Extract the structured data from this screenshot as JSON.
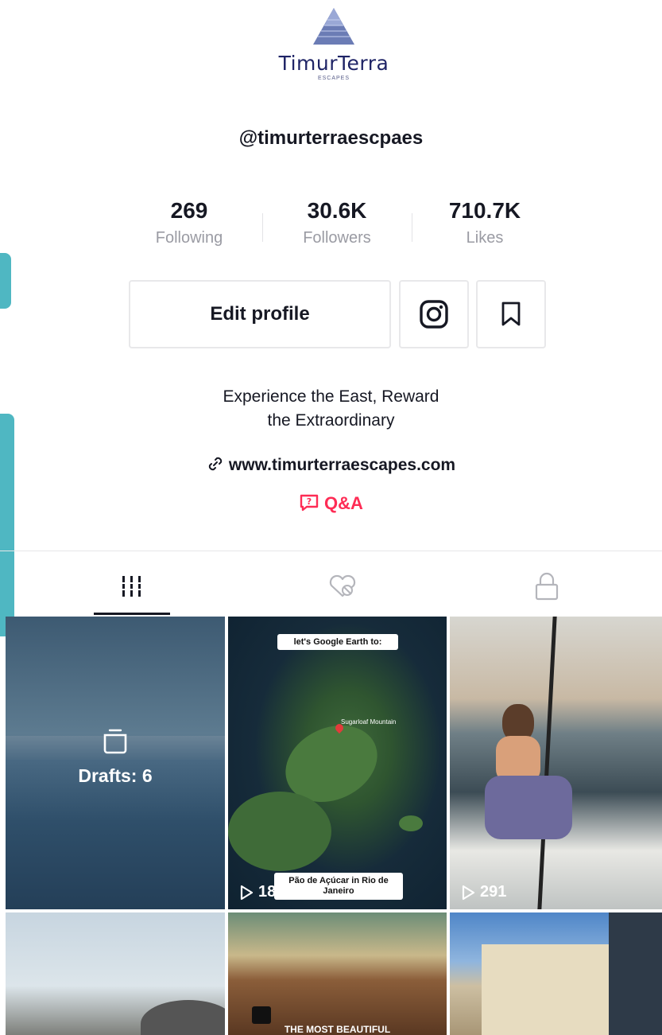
{
  "brand": {
    "name": "TimurTerra",
    "sub": "ESCAPES"
  },
  "profile": {
    "handle": "@timurterraescpaes",
    "bio_line1": "Experience the East, Reward",
    "bio_line2": "the Extraordinary",
    "website": "www.timurterraescapes.com",
    "qa_label": "Q&A"
  },
  "stats": [
    {
      "value": "269",
      "label": "Following"
    },
    {
      "value": "30.6K",
      "label": "Followers"
    },
    {
      "value": "710.7K",
      "label": "Likes"
    }
  ],
  "buttons": {
    "edit_profile": "Edit profile"
  },
  "tabs": [
    {
      "icon": "grid-icon",
      "selected": true
    },
    {
      "icon": "hidden-likes-icon",
      "selected": false
    },
    {
      "icon": "lock-icon",
      "selected": false
    }
  ],
  "grid": {
    "drafts_label": "Drafts: 6",
    "items": [
      {
        "caption_top": "let's Google Earth to:",
        "caption_bottom": "Pão de Açúcar in Rio de Janeiro",
        "map_label": "Sugarloaf Mountain",
        "plays": "183"
      },
      {
        "plays": "291"
      },
      {},
      {
        "caption_bottom": "THE MOST BEAUTIFUL"
      },
      {}
    ]
  },
  "colors": {
    "accent": "#fe2c55",
    "text": "#161823",
    "muted": "#9a9ba3",
    "logo": "#1f2466"
  }
}
